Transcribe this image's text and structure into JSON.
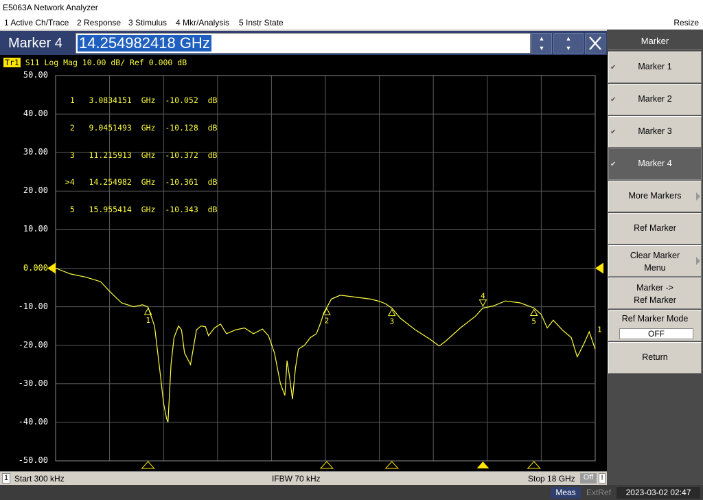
{
  "window": {
    "title": "E5063A Network Analyzer"
  },
  "menu": {
    "items": [
      "1 Active Ch/Trace",
      "2 Response",
      "3 Stimulus",
      "4 Mkr/Analysis",
      "5 Instr State"
    ],
    "resize": "Resize"
  },
  "entry": {
    "label": "Marker 4",
    "value": "14.254982418 GHz"
  },
  "trace": {
    "name": "Tr1",
    "header": "S11 Log Mag 10.00 dB/ Ref 0.000 dB",
    "color": "#ffff40"
  },
  "marker_table": [
    "  1   3.0834151  GHz  -10.052  dB",
    "  2   9.0451493  GHz  -10.128  dB",
    "  3   11.215913  GHz  -10.372  dB",
    " >4   14.254982  GHz  -10.361  dB",
    "  5   15.955414  GHz  -10.343  dB"
  ],
  "status": {
    "channel": "1",
    "start": "Start 300 kHz",
    "ifbw": "IFBW 70 kHz",
    "stop": "Stop 18 GHz",
    "off": "Off",
    "excl": "!"
  },
  "bottom": {
    "meas": "Meas",
    "extref": "ExtRef",
    "datetime": "2023-03-02 02:47"
  },
  "softkeys": {
    "title": "Marker",
    "items": [
      {
        "label": "Marker 1",
        "checked": true,
        "active": false
      },
      {
        "label": "Marker 2",
        "checked": true,
        "active": false
      },
      {
        "label": "Marker 3",
        "checked": true,
        "active": false
      },
      {
        "label": "Marker 4",
        "checked": true,
        "active": true
      },
      {
        "label": "More Markers",
        "submenu": true
      },
      {
        "label": "Ref Marker"
      },
      {
        "label": "Clear Marker Menu",
        "line1": "Clear Marker",
        "line2": "Menu",
        "submenu": true
      },
      {
        "label": "Marker -> Ref Marker",
        "line1": "Marker ->",
        "line2": "Ref Marker"
      },
      {
        "label": "Ref Marker Mode",
        "value": "OFF"
      },
      {
        "label": "Return"
      }
    ]
  },
  "chart_data": {
    "type": "line",
    "title": "",
    "xlabel": "",
    "ylabel": "",
    "xlim_ghz": [
      0.0003,
      18
    ],
    "ylim": [
      -50,
      50
    ],
    "y_ticks": [
      "50.00",
      "40.00",
      "30.00",
      "20.00",
      "10.00",
      "0.000",
      "-10.00",
      "-20.00",
      "-30.00",
      "-40.00",
      "-50.00"
    ],
    "grid": true,
    "series": [
      {
        "name": "S11",
        "x": [
          0.0003,
          0.5,
          1.0,
          1.5,
          1.8,
          2.2,
          2.6,
          2.9,
          3.08,
          3.3,
          3.5,
          3.6,
          3.7,
          3.75,
          3.85,
          3.95,
          4.1,
          4.2,
          4.3,
          4.5,
          4.7,
          4.85,
          5.0,
          5.1,
          5.3,
          5.5,
          5.7,
          6.0,
          6.3,
          6.6,
          6.9,
          7.1,
          7.3,
          7.5,
          7.65,
          7.72,
          7.8,
          7.9,
          8.0,
          8.1,
          8.3,
          8.5,
          8.7,
          8.85,
          8.95,
          9.05,
          9.2,
          9.5,
          10.0,
          10.5,
          10.8,
          11.0,
          11.22,
          11.5,
          12.0,
          12.5,
          12.8,
          13.0,
          13.5,
          14.0,
          14.25,
          14.6,
          15.0,
          15.5,
          15.96,
          16.2,
          16.4,
          16.6,
          16.9,
          17.2,
          17.4,
          17.6,
          17.8,
          18.0
        ],
        "y": [
          0.0,
          -1.5,
          -2.3,
          -3.5,
          -6.0,
          -9.0,
          -10.0,
          -9.5,
          -10.05,
          -15.0,
          -28.0,
          -35.0,
          -39.0,
          -40.0,
          -25.0,
          -18.0,
          -15.0,
          -16.0,
          -22.0,
          -25.0,
          -16.0,
          -15.0,
          -15.2,
          -17.5,
          -15.5,
          -14.5,
          -17.0,
          -16.0,
          -15.5,
          -17.0,
          -15.8,
          -17.5,
          -22.0,
          -30.0,
          -33.0,
          -24.0,
          -28.0,
          -34.0,
          -26.0,
          -21.0,
          -20.0,
          -18.0,
          -17.0,
          -14.0,
          -11.5,
          -10.13,
          -8.0,
          -7.0,
          -7.5,
          -8.0,
          -8.6,
          -9.2,
          -10.37,
          -13.0,
          -16.0,
          -18.5,
          -20.2,
          -19.0,
          -15.5,
          -12.5,
          -10.36,
          -9.8,
          -8.5,
          -9.0,
          -10.34,
          -12.0,
          -15.5,
          -13.5,
          -16.0,
          -18.0,
          -23.0,
          -20.0,
          -16.5,
          -21.0
        ]
      }
    ],
    "markers": [
      {
        "id": "1",
        "x": 3.0834151,
        "y": -10.052,
        "active": false
      },
      {
        "id": "2",
        "x": 9.0451493,
        "y": -10.128,
        "active": false
      },
      {
        "id": "3",
        "x": 11.215913,
        "y": -10.372,
        "active": false
      },
      {
        "id": "4",
        "x": 14.254982,
        "y": -10.361,
        "active": true
      },
      {
        "id": "5",
        "x": 15.955414,
        "y": -10.343,
        "active": false
      }
    ],
    "trace_end_label": "1"
  }
}
